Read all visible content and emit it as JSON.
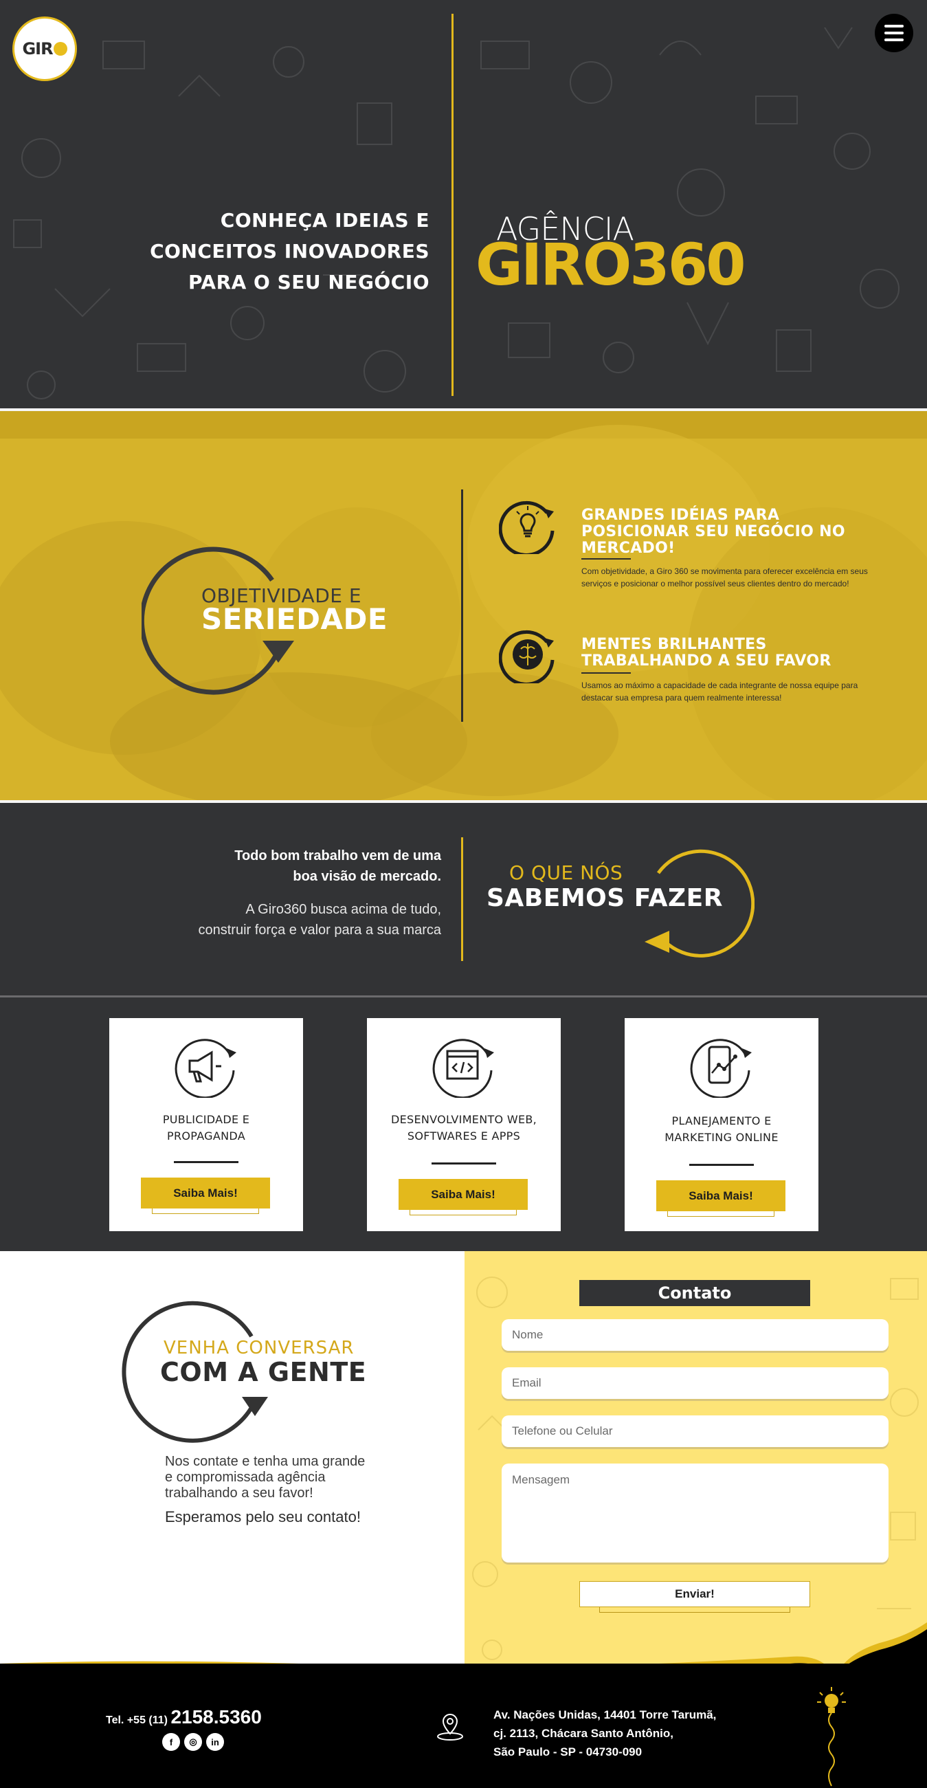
{
  "header": {
    "logo_text": "GIR",
    "tagline_lines": [
      "CONHEÇA IDEIAS E",
      "CONCEITOS INOVADORES",
      "PARA O SEU NEGÓCIO"
    ],
    "agencia": "AGÊNCIA",
    "brand": "GIRO360",
    "menu_icon": "hamburger-icon"
  },
  "values": {
    "heading_small": "OBJETIVIDADE E",
    "heading_big": "SERIEDADE",
    "features": [
      {
        "icon": "lightbulb-icon",
        "title_lines": [
          "GRANDES IDÉIAS PARA",
          "POSICIONAR SEU NEGÓCIO NO",
          "MERCADO!"
        ],
        "description": "Com objetividade, a Giro 360 se movimenta para oferecer excelência em seus serviços e posicionar o melhor possível seus clientes dentro do mercado!"
      },
      {
        "icon": "brain-icon",
        "title_lines": [
          "MENTES BRILHANTES",
          "TRABALHANDO A SEU FAVOR"
        ],
        "description": "Usamos ao máximo a capacidade de cada integrante de nossa equipe para destacar sua empresa para quem realmente interessa!"
      }
    ]
  },
  "vision": {
    "bold_lines": [
      "Todo bom trabalho vem de uma",
      "boa visão de mercado."
    ],
    "regular_lines": [
      "A Giro360 busca acima de tudo,",
      "construir força e valor para a sua marca"
    ],
    "heading_small": "O QUE NÓS",
    "heading_big": "SABEMOS FAZER"
  },
  "services": [
    {
      "icon": "megaphone-icon",
      "title_lines": [
        "PUBLICIDADE E",
        "PROPAGANDA"
      ],
      "button": "Saiba Mais!"
    },
    {
      "icon": "code-window-icon",
      "title_lines": [
        "DESENVOLVIMENTO WEB,",
        "SOFTWARES E APPS"
      ],
      "button": "Saiba Mais!"
    },
    {
      "icon": "mobile-analytics-icon",
      "title_lines": [
        "PLANEJAMENTO E",
        "MARKETING ONLINE"
      ],
      "button": "Saiba Mais!"
    }
  ],
  "contact": {
    "heading_small": "VENHA CONVERSAR",
    "heading_big": "COM A GENTE",
    "paragraph_lines": [
      "Nos contate e tenha uma grande",
      "e compromissada agência",
      "trabalhando a seu favor!"
    ],
    "closing": "Esperamos pelo seu contato!",
    "form_title": "Contato",
    "fields": {
      "name_placeholder": "Nome",
      "email_placeholder": "Email",
      "phone_placeholder": "Telefone ou Celular",
      "message_placeholder": "Mensagem"
    },
    "submit": "Enviar!"
  },
  "footer": {
    "tel_prefix": "Tel. +55 (11)",
    "tel_number": "2158.5360",
    "socials": [
      {
        "icon": "facebook-icon",
        "glyph": "f"
      },
      {
        "icon": "instagram-icon",
        "glyph": "◎"
      },
      {
        "icon": "linkedin-icon",
        "glyph": "in"
      }
    ],
    "address_lines": [
      "Av. Nações Unidas, 14401 Torre Tarumã,",
      "cj. 2113, Chácara Santo Antônio,",
      "São Paulo - SP - 04730-090"
    ],
    "location_icon": "map-pin-icon"
  },
  "colors": {
    "brand_yellow": "#e3b91c",
    "dark_gray": "#323335",
    "light_yellow": "#fde477"
  }
}
